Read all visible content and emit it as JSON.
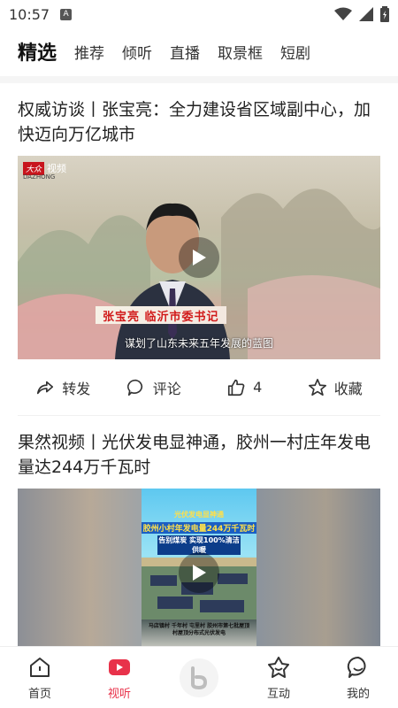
{
  "status": {
    "time": "10:57",
    "notif": "A"
  },
  "tabs": [
    {
      "label": "精选"
    },
    {
      "label": "推荐"
    },
    {
      "label": "倾听"
    },
    {
      "label": "直播"
    },
    {
      "label": "取景框"
    },
    {
      "label": "短剧"
    }
  ],
  "articles": [
    {
      "title": "权威访谈丨张宝亮：全力建设省区域副中心，加快迈向万亿城市",
      "video": {
        "logo_mark": "大众",
        "logo_text": "视频",
        "logo_sub": "DAZHONG",
        "banner": "张宝亮 临沂市委书记",
        "caption": "谋划了山东未来五年发展的蓝图"
      },
      "actions": {
        "share": "转发",
        "comment": "评论",
        "like_count": "4",
        "collect": "收藏"
      }
    },
    {
      "title": "果然视频丨光伏发电显神通，胶州一村庄年发电量达244万千瓦时",
      "video": {
        "poster_line1": "光伏发电显神通",
        "poster_line2": "胶州小村年发电量244万千瓦时",
        "poster_line3": "告别煤炭 实现100%清洁供暖",
        "poster_line4": "马店镇村 千年村 屯里村 胶州市第七批屋顶村屋顶分布式光伏发电"
      }
    }
  ],
  "bottom_nav": [
    {
      "label": "首页"
    },
    {
      "label": "视听"
    },
    {
      "label": "互动"
    },
    {
      "label": "我的"
    }
  ],
  "colors": {
    "accent": "#e8324a",
    "banner_text": "#d11a1a"
  }
}
